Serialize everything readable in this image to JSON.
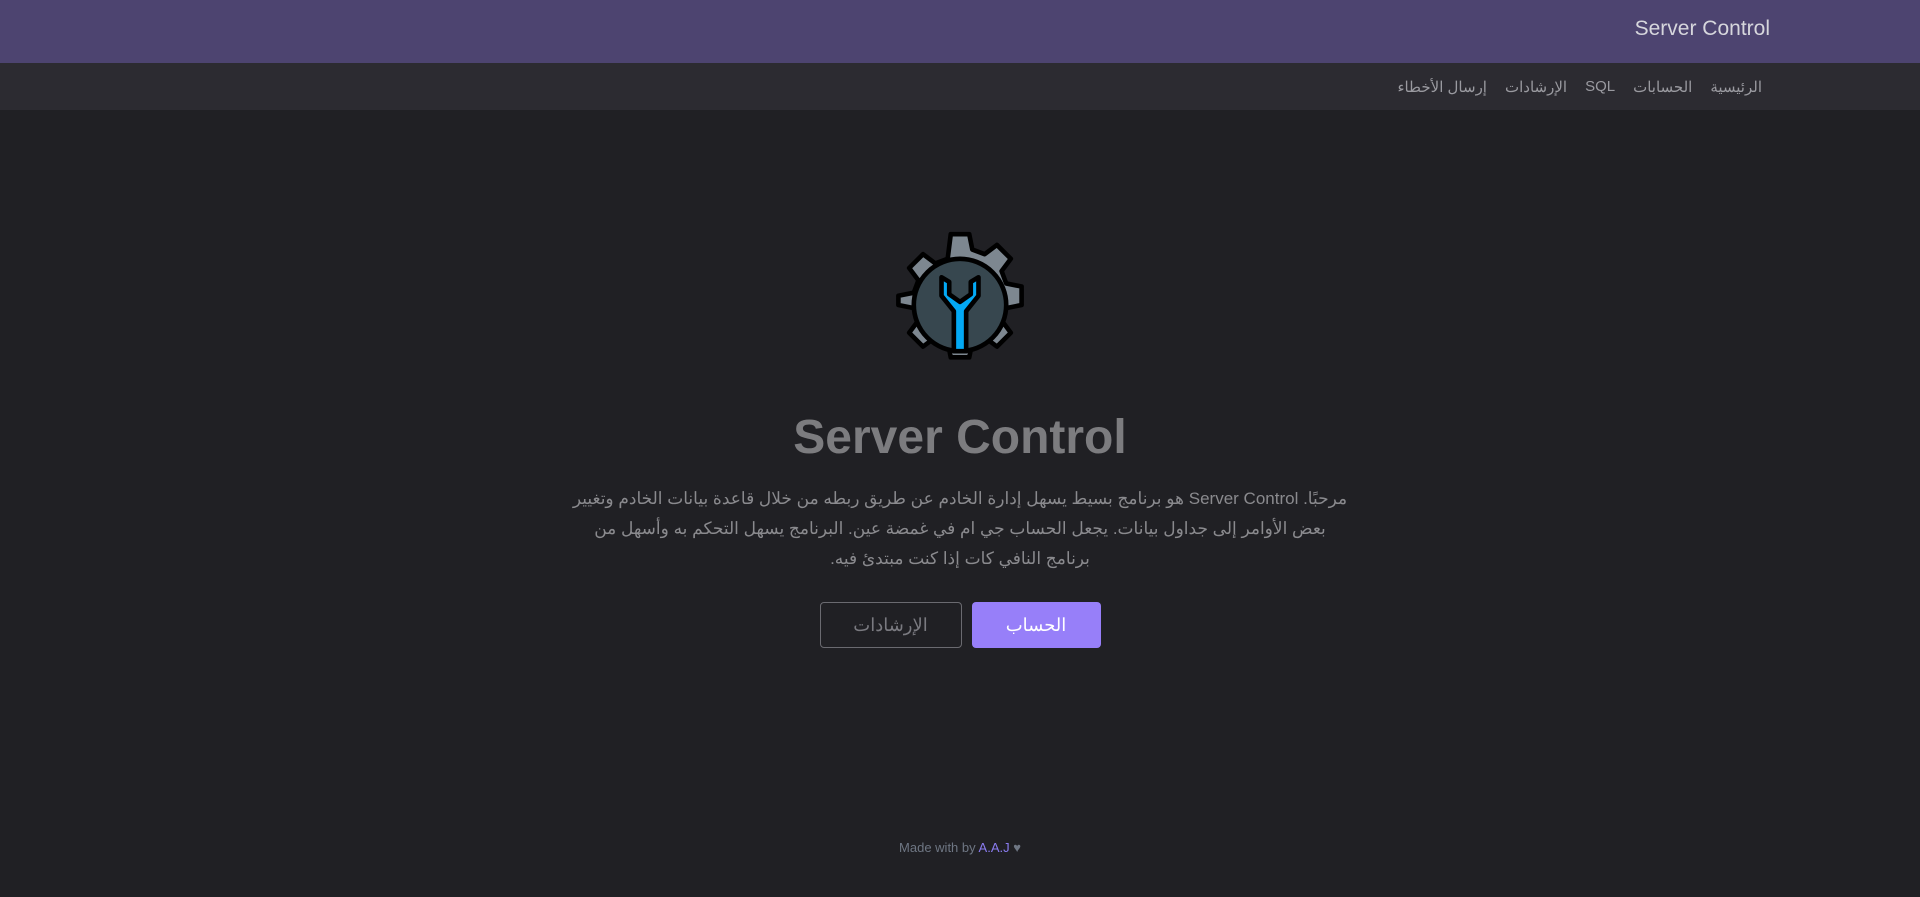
{
  "header": {
    "title": "Server Control"
  },
  "nav": {
    "items": [
      "الرئيسية",
      "الحسابات",
      "SQL",
      "الإرشادات",
      "إرسال الأخطاء"
    ]
  },
  "main": {
    "logo_icon": "gear-wrench-icon",
    "title": "Server Control",
    "description": "مرحبًا. Server Control هو برنامج بسيط يسهل إدارة الخادم عن طريق ربطه من خلال قاعدة بيانات الخادم وتغيير بعض الأوامر إلى جداول بيانات. يجعل الحساب جي ام في غمضة عين. البرنامج يسهل التحكم به وأسهل من برنامج النافي كات إذا كنت مبتدئ فيه.",
    "primary_button": "الحساب",
    "secondary_button": "الإرشادات"
  },
  "footer": {
    "prefix": "Made with by",
    "author": "A.A.J",
    "heart": "♥"
  },
  "colors": {
    "header": "#4d4470",
    "accent": "#977ff9",
    "background": "#202024"
  }
}
